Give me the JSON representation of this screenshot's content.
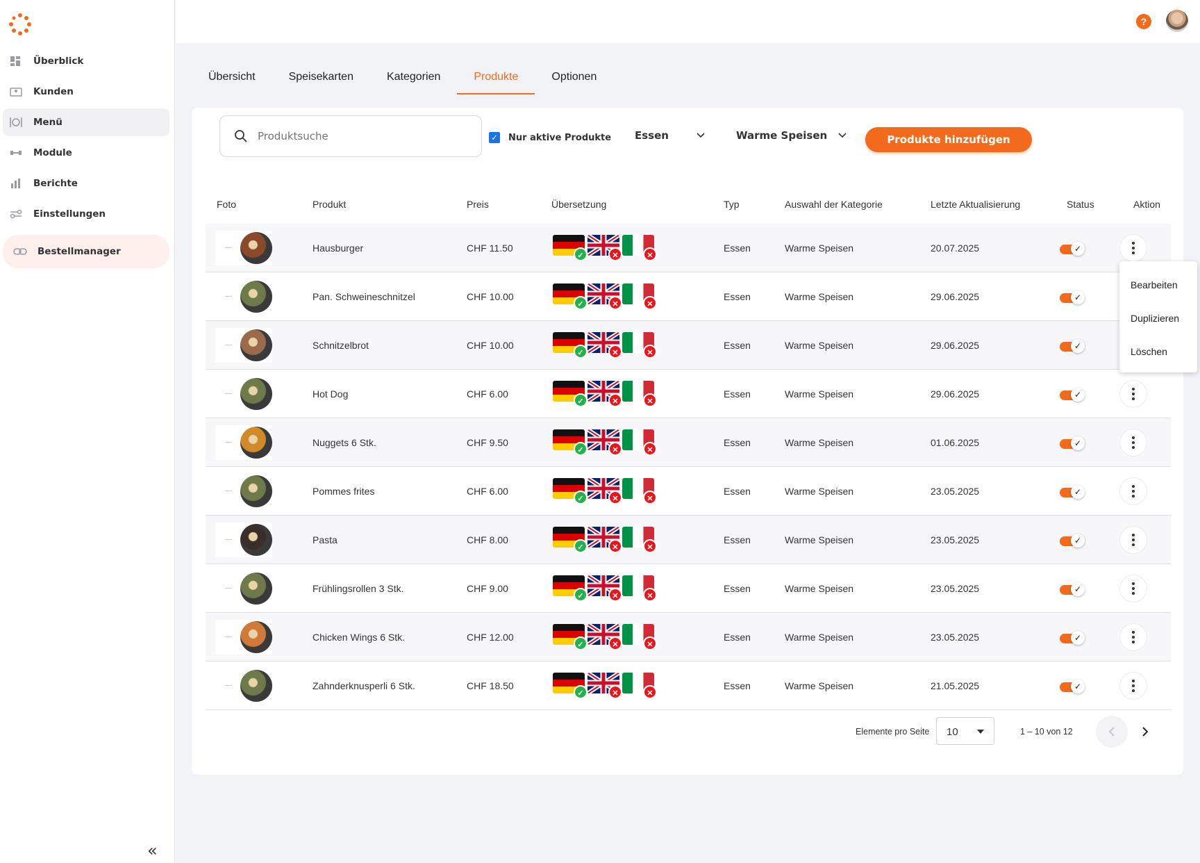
{
  "colors": {
    "accent": "#f26a1b",
    "ok": "#22b24c",
    "error": "#e8161b",
    "checkbox": "#1a73e8"
  },
  "sidebar": {
    "items": [
      {
        "label": "Überblick",
        "icon": "dashboard-icon"
      },
      {
        "label": "Kunden",
        "icon": "customers-icon"
      },
      {
        "label": "Menü",
        "icon": "menu-icon",
        "active": true
      },
      {
        "label": "Module",
        "icon": "modules-icon"
      },
      {
        "label": "Berichte",
        "icon": "reports-icon"
      },
      {
        "label": "Einstellungen",
        "icon": "settings-icon"
      },
      {
        "label": "Bestellmanager",
        "icon": "link-icon",
        "highlight": true
      }
    ],
    "collapse_icon": "«"
  },
  "header": {
    "help_label": "?"
  },
  "tabs": [
    {
      "label": "Übersicht"
    },
    {
      "label": "Speisekarten"
    },
    {
      "label": "Kategorien"
    },
    {
      "label": "Produkte",
      "active": true
    },
    {
      "label": "Optionen"
    }
  ],
  "toolbar": {
    "search_placeholder": "Produktsuche",
    "active_only_label": "Nur aktive Produkte",
    "active_only_checked": true,
    "type_filter": "Essen",
    "category_filter": "Warme Speisen",
    "add_button": "Produkte hinzufügen"
  },
  "table": {
    "columns": [
      "Foto",
      "Produkt",
      "Preis",
      "Übersetzung",
      "Typ",
      "Auswahl der Kategorie",
      "Letzte Aktualisierung",
      "Status",
      "Aktion"
    ],
    "rows": [
      {
        "produkt": "Hausburger",
        "preis": "CHF 11.50",
        "typ": "Essen",
        "kategorie": "Warme Speisen",
        "datum": "20.07.2025",
        "food": "#8a4a2a"
      },
      {
        "produkt": "Pan. Schweineschnitzel",
        "preis": "CHF 10.00",
        "typ": "Essen",
        "kategorie": "Warme Speisen",
        "datum": "29.06.2025",
        "food": "#6f7a4a"
      },
      {
        "produkt": "Schnitzelbrot",
        "preis": "CHF 10.00",
        "typ": "Essen",
        "kategorie": "Warme Speisen",
        "datum": "29.06.2025",
        "food": "#9a6a4a"
      },
      {
        "produkt": "Hot Dog",
        "preis": "CHF 6.00",
        "typ": "Essen",
        "kategorie": "Warme Speisen",
        "datum": "29.06.2025",
        "food": "#6f7a4a"
      },
      {
        "produkt": "Nuggets 6 Stk.",
        "preis": "CHF 9.50",
        "typ": "Essen",
        "kategorie": "Warme Speisen",
        "datum": "01.06.2025",
        "food": "#d08a2a"
      },
      {
        "produkt": "Pommes frites",
        "preis": "CHF 6.00",
        "typ": "Essen",
        "kategorie": "Warme Speisen",
        "datum": "23.05.2025",
        "food": "#6f7a4a"
      },
      {
        "produkt": "Pasta",
        "preis": "CHF 8.00",
        "typ": "Essen",
        "kategorie": "Warme Speisen",
        "datum": "23.05.2025",
        "food": "#3a2e2a"
      },
      {
        "produkt": "Frühlingsrollen 3 Stk.",
        "preis": "CHF 9.00",
        "typ": "Essen",
        "kategorie": "Warme Speisen",
        "datum": "23.05.2025",
        "food": "#6f7a4a"
      },
      {
        "produkt": "Chicken Wings 6 Stk.",
        "preis": "CHF 12.00",
        "typ": "Essen",
        "kategorie": "Warme Speisen",
        "datum": "23.05.2025",
        "food": "#d07a3a"
      },
      {
        "produkt": "Zahnderknusperli 6 Stk.",
        "preis": "CHF 18.50",
        "typ": "Essen",
        "kategorie": "Warme Speisen",
        "datum": "21.05.2025",
        "food": "#6f7a4a"
      }
    ]
  },
  "context_menu": {
    "items": [
      "Bearbeiten",
      "Duplizieren",
      "Löschen"
    ]
  },
  "pagination": {
    "per_page_label": "Elemente pro Seite",
    "per_page": "10",
    "range": "1 – 10 von 12"
  }
}
